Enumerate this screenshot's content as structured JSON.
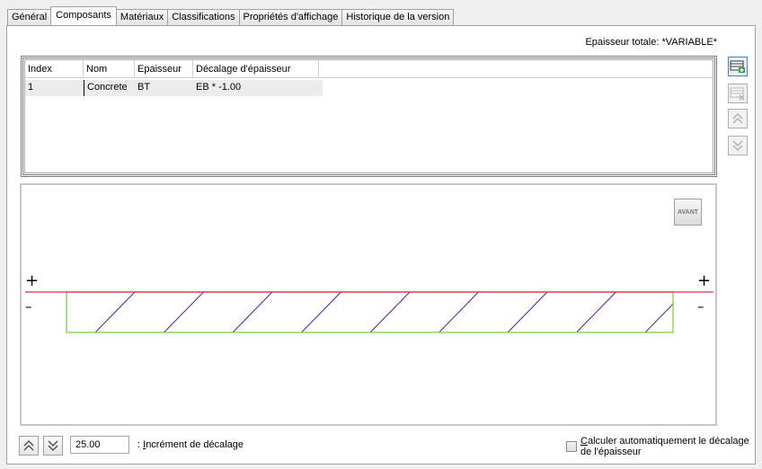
{
  "tabs": [
    "Général",
    "Composants",
    "Matériaux",
    "Classifications",
    "Propriétés d'affichage",
    "Historique de la version"
  ],
  "active_tab_index": 1,
  "total_thickness": "Epaisseur totale: *VARIABLE*",
  "grid": {
    "headers": [
      "Index",
      "Nom",
      "Epaisseur",
      "Décalage d'épaisseur"
    ],
    "rows": [
      [
        "1",
        "Concrete",
        "BT",
        "EB * -1.00"
      ]
    ]
  },
  "side_buttons": [
    {
      "name": "add-component-button",
      "icon": "add-row-icon",
      "enabled": true
    },
    {
      "name": "remove-component-button",
      "icon": "remove-row-icon",
      "enabled": false
    },
    {
      "name": "move-up-button",
      "icon": "double-chevron-up-icon",
      "enabled": false
    },
    {
      "name": "move-down-button",
      "icon": "double-chevron-down-icon",
      "enabled": false
    }
  ],
  "preview": {
    "avant_label": "AVANT",
    "plus": "+",
    "minus": "–",
    "colors": {
      "reference_line": "#d03040",
      "component_outline": "#80d040",
      "hatch": "#5020a0"
    }
  },
  "offset": {
    "value": "25.00",
    "label_prefix": ": ",
    "label_mnemonic": "I",
    "label_rest": "ncrément de décalage"
  },
  "auto_calc": {
    "checked": false,
    "label_mnemonic": "C",
    "label_rest": "alculer automatiquement le décalage de l'épaisseur"
  }
}
